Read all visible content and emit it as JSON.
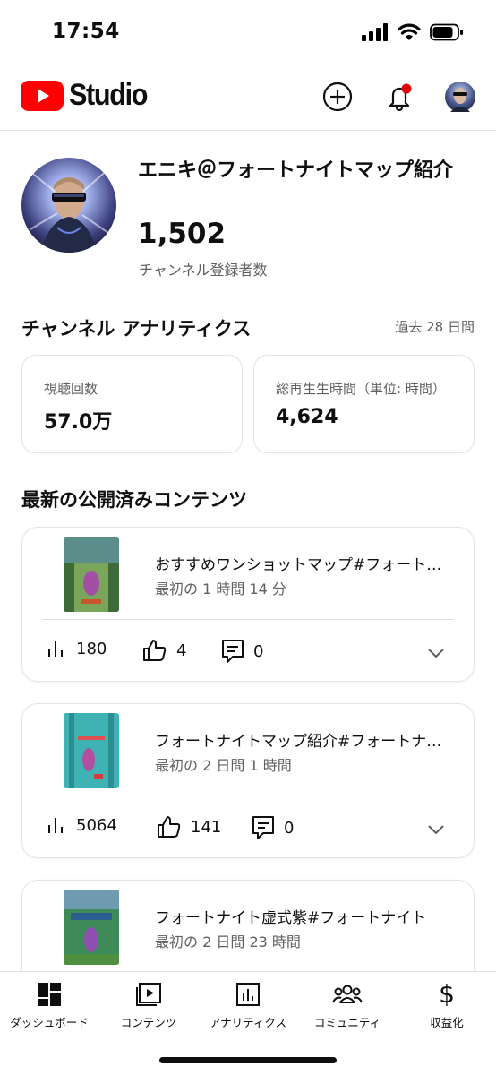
{
  "status_bar": {
    "time": "17:54"
  },
  "header": {
    "logo_text": "Studio",
    "colors": {
      "brand_red": "#ff0000",
      "notification_dot": "#e00000"
    }
  },
  "channel": {
    "name": "エニキ＠フォートナイトマップ紹介",
    "subscriber_count": "1,502",
    "subscriber_label": "チャンネル登録者数"
  },
  "analytics": {
    "title": "チャンネル アナリティクス",
    "period": "過去 28 日間",
    "views": {
      "label": "視聴回数",
      "value": "57.0万"
    },
    "watch_time": {
      "label": "総再生生時間（単位: 時間）",
      "value": "4,624"
    }
  },
  "latest": {
    "title": "最新の公開済みコンテンツ",
    "videos": [
      {
        "title": "おすすめワンショットマップ#フォートナイト",
        "age": "最初の 1 時間 14 分",
        "views": "180",
        "likes": "4",
        "comments": "0"
      },
      {
        "title": "フォートナイトマップ紹介#フォートナイト",
        "age": "最初の 2 日間 1 時間",
        "views": "5064",
        "likes": "141",
        "comments": "0"
      },
      {
        "title": "フォートナイト虚式紫#フォートナイト",
        "age": "最初の 2 日間 23 時間"
      }
    ]
  },
  "bottom_nav": {
    "items": [
      {
        "label": "ダッシュボード",
        "icon": "dashboard-icon"
      },
      {
        "label": "コンテンツ",
        "icon": "content-icon"
      },
      {
        "label": "アナリティクス",
        "icon": "analytics-icon"
      },
      {
        "label": "コミュニティ",
        "icon": "community-icon"
      },
      {
        "label": "収益化",
        "icon": "dollar-icon"
      }
    ]
  }
}
